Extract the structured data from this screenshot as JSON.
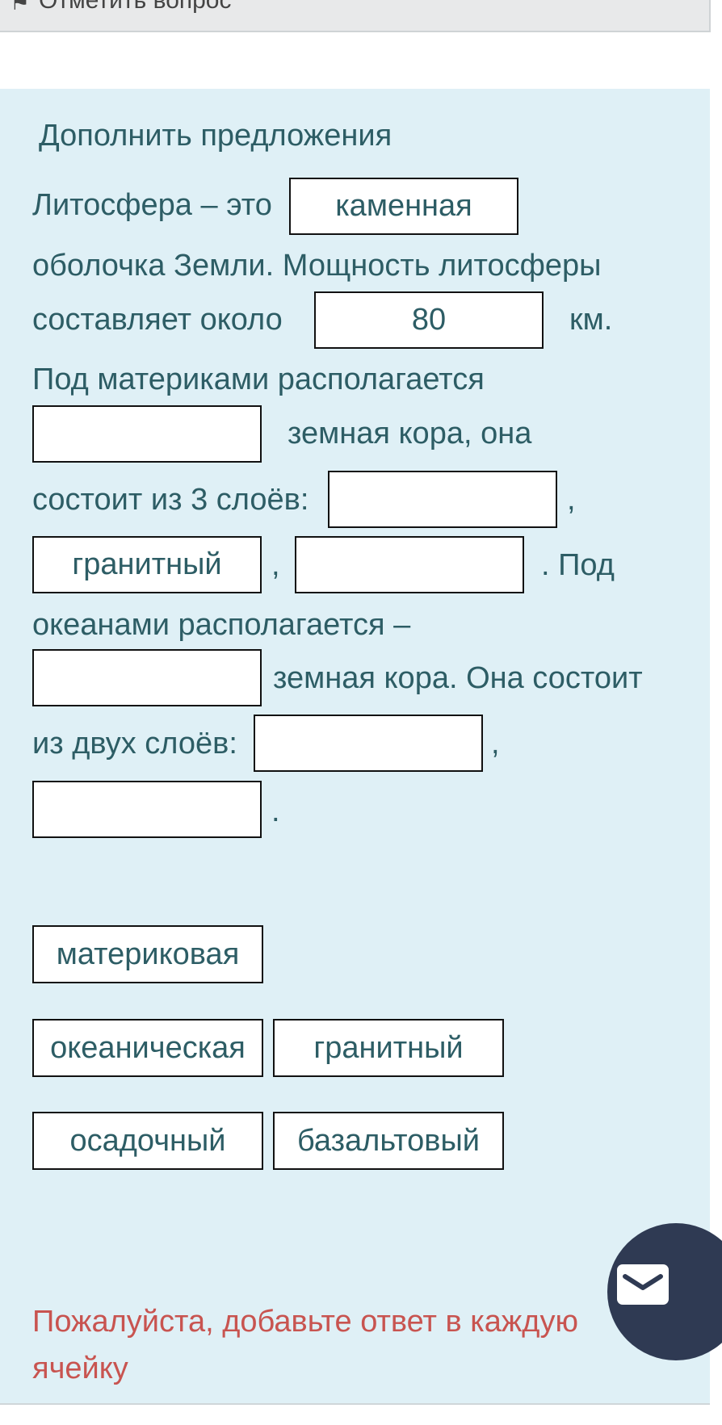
{
  "header": {
    "flag_label": "Отметить вопрос"
  },
  "question": {
    "title": "Дополнить предложения",
    "text": {
      "t1": "Литосфера – это",
      "t2": "оболочка Земли. Мощность литосферы",
      "t3": "составляет около",
      "t4": "км.",
      "t5": "Под материками располагается",
      "t6": "земная кора, она",
      "t7": "состоит из 3 слоёв:",
      "comma": ",",
      "dot_under": ".  Под",
      "t8": "океанами располагается –",
      "t9": "земная кора. Она состоит",
      "t10": "из двух слоёв:",
      "period": "."
    },
    "slots": {
      "s1": "каменная",
      "s2": "80",
      "s3": "",
      "s4": "",
      "s5": "гранитный",
      "s6": "",
      "s7": "",
      "s8": "",
      "s9": ""
    },
    "options": [
      "материковая",
      "океаническая",
      "гранитный",
      "осадочный",
      "базальтовый"
    ]
  },
  "validation": {
    "message": "Пожалуйста, добавьте ответ в каждую ячейку"
  },
  "fab": {
    "icon": "envelope-icon"
  }
}
